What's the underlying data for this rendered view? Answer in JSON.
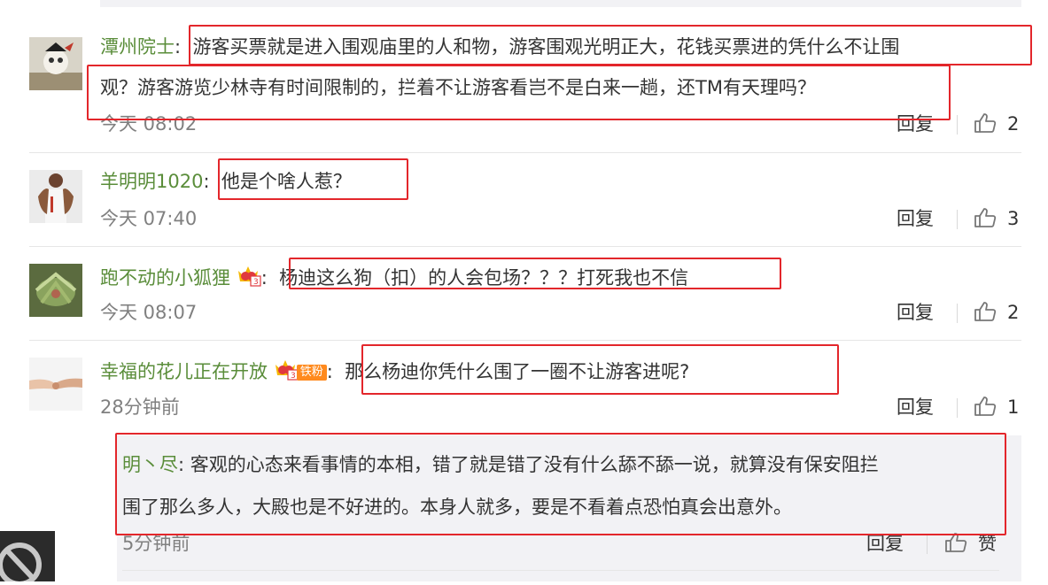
{
  "comments": [
    {
      "user": "潭州院士",
      "colon": ":",
      "text_line1": "游客买票就是进入围观庙里的人和物，游客围观光明正大，花钱买票进的凭什么不让围",
      "text_line2": "观？游客游览少林寺有时间限制的，拦着不让游客看岂不是白来一趟，还TM有天理吗？",
      "time": "今天 08:02",
      "reply": "回复",
      "likes": "2"
    },
    {
      "user": "羊明明1020",
      "colon": ":",
      "text_line1": "他是个啥人惹？",
      "time": "今天 07:40",
      "reply": "回复",
      "likes": "3"
    },
    {
      "user": "跑不动的小狐狸",
      "colon": ":",
      "text_line1": "杨迪这么狗（扣）的人会包场？？？打死我也不信",
      "time": "今天 08:07",
      "reply": "回复",
      "likes": "2"
    },
    {
      "user": "幸福的花儿正在开放",
      "badge_label": "铁粉",
      "colon": ":",
      "text_line1": "那么杨迪你凭什么围了一圈不让游客进呢?",
      "time": "28分钟前",
      "reply": "回复",
      "likes": "1"
    }
  ],
  "subreply": {
    "user": "明丶尽",
    "colon": ":",
    "text_line1": "客观的心态来看事情的本相，错了就是错了没有什么舔不舔一说，就算没有保安阻拦",
    "text_line2": "围了那么多人，大殿也是不好进的。本身人就多，要是不看着点恐怕真会出意外。",
    "time": "5分钟前",
    "reply": "回复",
    "like_label": "赞"
  },
  "colors": {
    "username": "#5a8d3a",
    "highlight_box": "#e3262b",
    "timestamp": "#808080"
  }
}
